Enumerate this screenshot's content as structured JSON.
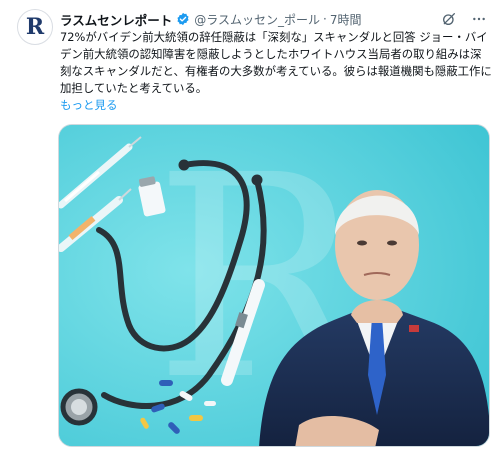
{
  "account": {
    "avatar_letter": "R",
    "display_name": "ラスムセンレポート",
    "handle": "@ラスムッセン_ポール",
    "separator": "·",
    "time": "7時間"
  },
  "tweet": {
    "text": "72%がバイデン前大統領の辞任隠蔽は「深刻な」スキャンダルと回答 ジョー・バイデン前大統領の認知障害を隠蔽しようとしたホワイトハウス当局者の取り組みは深刻なスキャンダルだと、有権者の大多数が考えている。彼らは報道機関も隠蔽工作に加担していたと考えている。",
    "show_more": "もっと見る"
  },
  "icons": {
    "verified": "verified-badge-icon",
    "grok": "grok-icon",
    "more": "more-options-icon"
  },
  "colors": {
    "link": "#1d9bf0",
    "image_background": "#4fd0dc",
    "suit": "#1c2d4f",
    "tie": "#2e63c9"
  }
}
